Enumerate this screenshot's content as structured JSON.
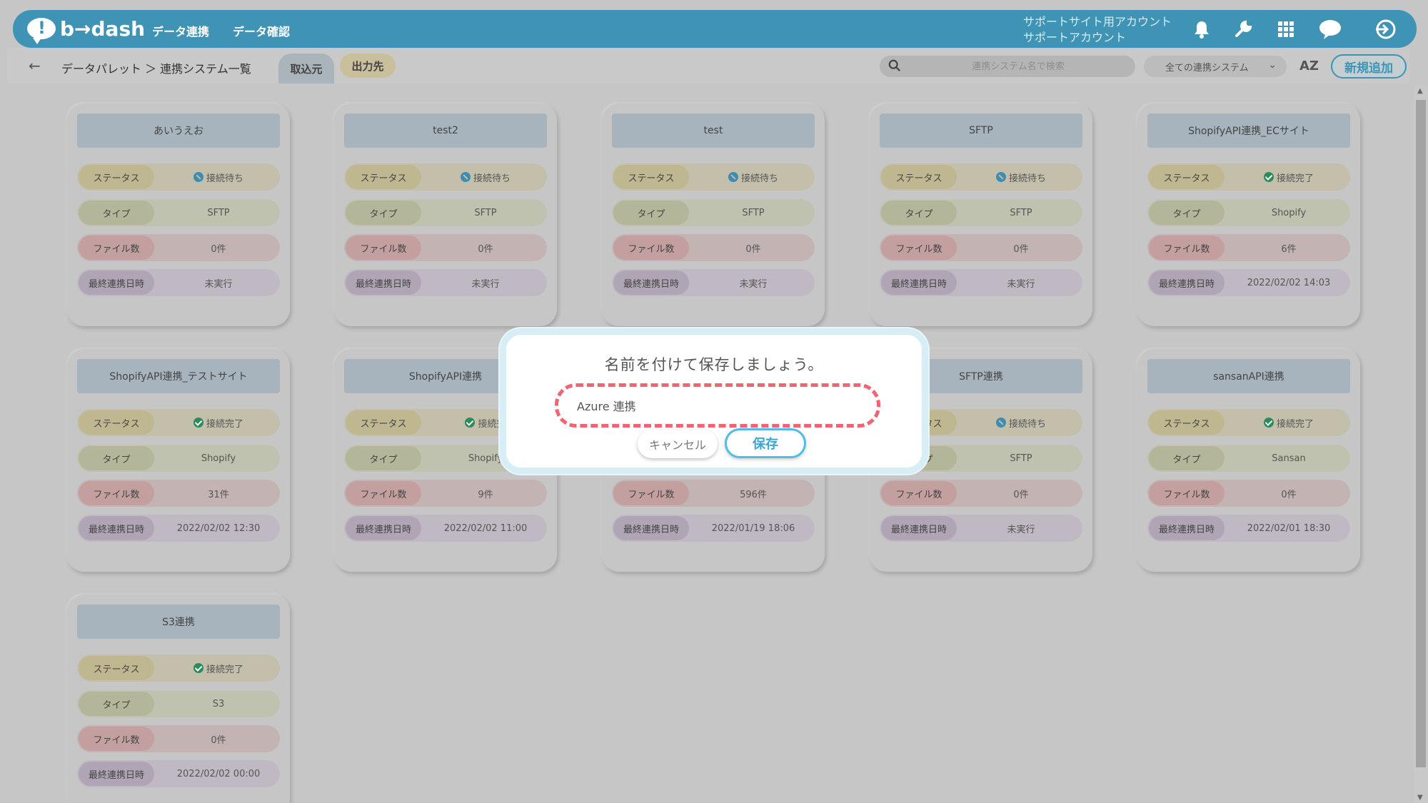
{
  "header": {
    "logo_text": "b→dash",
    "nav": [
      "データ連携",
      "データ確認"
    ],
    "account_line1": "サポートサイト用アカウント",
    "account_line2": "サポートアカウント",
    "icons": [
      "bell-icon",
      "wrench-icon",
      "grid-icon",
      "chat-icon",
      "logout-icon"
    ]
  },
  "subbar": {
    "breadcrumb": "データパレット ＞ 連携システム一覧",
    "tab_in": "取込元",
    "tab_out": "出力先",
    "search_placeholder": "連携システム名で検索",
    "filter_value": "全ての連携システム",
    "sort_label": "AZ",
    "new_button": "新規追加"
  },
  "labels": {
    "status": "ステータス",
    "type": "タイプ",
    "files": "ファイル数",
    "last": "最終連携日時"
  },
  "cards": [
    {
      "name": "あいうえお",
      "status": "接続待ち",
      "status_kind": "wait",
      "type": "SFTP",
      "files": "0件",
      "last": "未実行"
    },
    {
      "name": "test2",
      "status": "接続待ち",
      "status_kind": "wait",
      "type": "SFTP",
      "files": "0件",
      "last": "未実行"
    },
    {
      "name": "test",
      "status": "接続待ち",
      "status_kind": "wait",
      "type": "SFTP",
      "files": "0件",
      "last": "未実行"
    },
    {
      "name": "SFTP",
      "status": "接続待ち",
      "status_kind": "wait",
      "type": "SFTP",
      "files": "0件",
      "last": "未実行"
    },
    {
      "name": "ShopifyAPI連携_ECサイト",
      "status": "接続完了",
      "status_kind": "done",
      "type": "Shopify",
      "files": "6件",
      "last": "2022/02/02 14:03"
    },
    {
      "name": "ShopifyAPI連携_テストサイト",
      "status": "接続完了",
      "status_kind": "done",
      "type": "Shopify",
      "files": "31件",
      "last": "2022/02/02 12:30"
    },
    {
      "name": "ShopifyAPI連携",
      "status": "接続完",
      "status_kind": "done",
      "type": "Shopify",
      "files": "9件",
      "last": "2022/02/02 11:00"
    },
    {
      "name": "",
      "status": "",
      "status_kind": "",
      "type": "",
      "files": "596件",
      "last": "2022/01/19 18:06"
    },
    {
      "name": "SFTP連携",
      "status": "接続待ち",
      "status_kind": "wait",
      "type": "SFTP",
      "files": "0件",
      "last": "未実行"
    },
    {
      "name": "sansanAPI連携",
      "status": "接続完了",
      "status_kind": "done",
      "type": "Sansan",
      "files": "0件",
      "last": "2022/02/01 18:30"
    },
    {
      "name": "S3連携",
      "status": "接続完了",
      "status_kind": "done",
      "type": "S3",
      "files": "0件",
      "last": "2022/02/02 00:00"
    }
  ],
  "modal": {
    "title": "名前を付けて保存しましょう。",
    "input_value": "Azure 連携",
    "cancel": "キャンセル",
    "save": "保存"
  }
}
